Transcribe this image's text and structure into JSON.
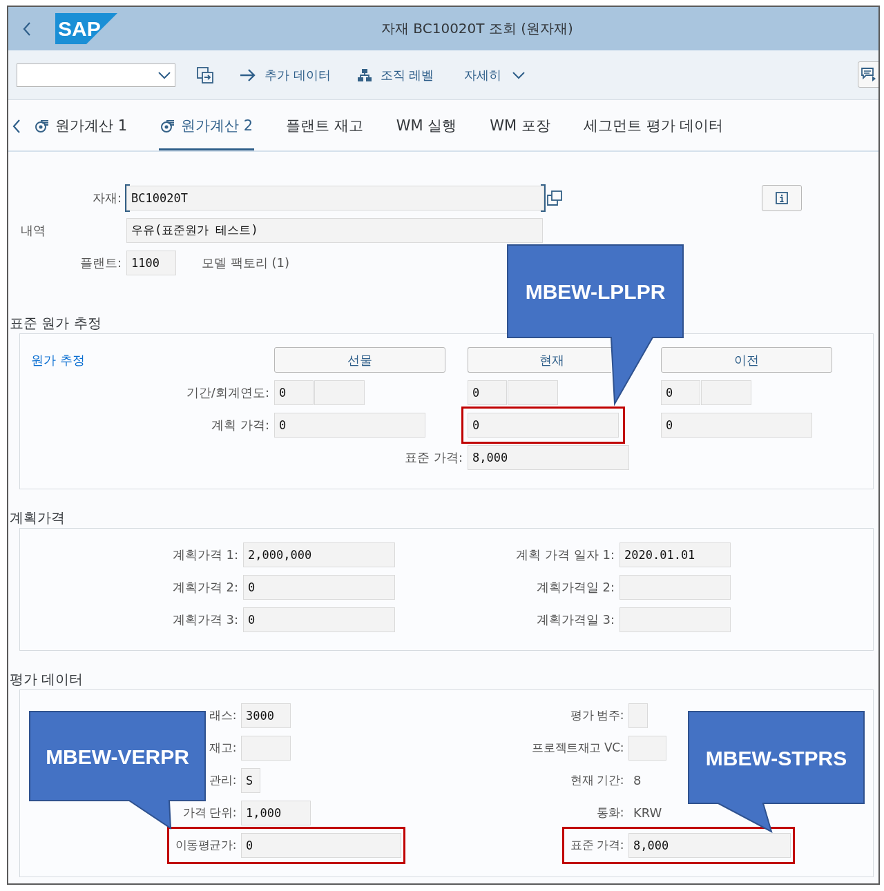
{
  "header": {
    "logo": "SAP",
    "title": "자재 BC10020T 조회 (원자재)"
  },
  "toolbar": {
    "items": [
      {
        "kind": "dropdown"
      },
      {
        "kind": "icon-button"
      },
      {
        "kind": "arrow-action",
        "label": "추가 데이터"
      },
      {
        "kind": "hierarchy-action",
        "label": "조직 레벨"
      },
      {
        "kind": "menu",
        "label": "자세히"
      }
    ]
  },
  "tabs": [
    {
      "label": "원가계산 1",
      "selected": false,
      "has_icon": true
    },
    {
      "label": "원가계산 2",
      "selected": true,
      "has_icon": true
    },
    {
      "label": "플랜트 재고",
      "selected": false,
      "has_icon": false
    },
    {
      "label": "WM 실행",
      "selected": false,
      "has_icon": false
    },
    {
      "label": "WM 포장",
      "selected": false,
      "has_icon": false
    },
    {
      "label": "세그먼트 평가 데이터",
      "selected": false,
      "has_icon": false
    }
  ],
  "material": {
    "label": "자재:",
    "value": "BC10020T"
  },
  "description": {
    "label": "내역",
    "value": "우유(표준원가 테스트)"
  },
  "plant": {
    "label": "플랜트:",
    "value": "1100",
    "name": "모델 팩토리 (1)"
  },
  "cost_estimate": {
    "title": "표준 원가 추정",
    "link": "원가 추정",
    "period_label": "기간/회계연도:",
    "plan_price_label": "계획 가격:",
    "columns": [
      {
        "label": "선물",
        "period": "0",
        "plan_price": "0",
        "highlighted": false
      },
      {
        "label": "현재",
        "period": "0",
        "plan_price": "0",
        "highlighted": true
      },
      {
        "label": "이전",
        "period": "0",
        "plan_price": "0",
        "highlighted": false
      }
    ],
    "standard_price": {
      "label": "표준 가격:",
      "value": "8,000"
    }
  },
  "planned_prices": {
    "title": "계획가격",
    "left": [
      {
        "label": "계획가격 1:",
        "value": "2,000,000"
      },
      {
        "label": "계획가격 2:",
        "value": "0"
      },
      {
        "label": "계획가격 3:",
        "value": "0"
      }
    ],
    "right": [
      {
        "label": "계획 가격 일자 1:",
        "value": "2020.01.01"
      },
      {
        "label": "계획가격일 2:"
      },
      {
        "label": "계획가격일 3:"
      }
    ]
  },
  "valuation": {
    "title": "평가 데이터",
    "left": [
      {
        "label": "래스:",
        "value": "3000",
        "highlighted": false
      },
      {
        "label": "재고:",
        "highlighted": false
      },
      {
        "label": "관리:",
        "value": "S",
        "highlighted": false
      },
      {
        "label": "가격 단위:",
        "value": "1,000",
        "highlighted": false
      },
      {
        "label": "이동평균가:",
        "value": "0",
        "highlighted": true
      }
    ],
    "right": [
      {
        "label": "평가 범주:",
        "kind": "field",
        "highlighted": false
      },
      {
        "label": "프로젝트재고 VC:",
        "kind": "field",
        "highlighted": false
      },
      {
        "label": "현재 기간:",
        "kind": "text",
        "value": "8",
        "highlighted": false
      },
      {
        "label": "통화:",
        "kind": "text",
        "value": "KRW",
        "highlighted": false
      },
      {
        "label": "표준 가격:",
        "kind": "field",
        "value": "8,000",
        "highlighted": true
      }
    ]
  },
  "callouts": [
    {
      "text": "MBEW-LPLPR"
    },
    {
      "text": "MBEW-VERPR"
    },
    {
      "text": "MBEW-STPRS"
    }
  ]
}
